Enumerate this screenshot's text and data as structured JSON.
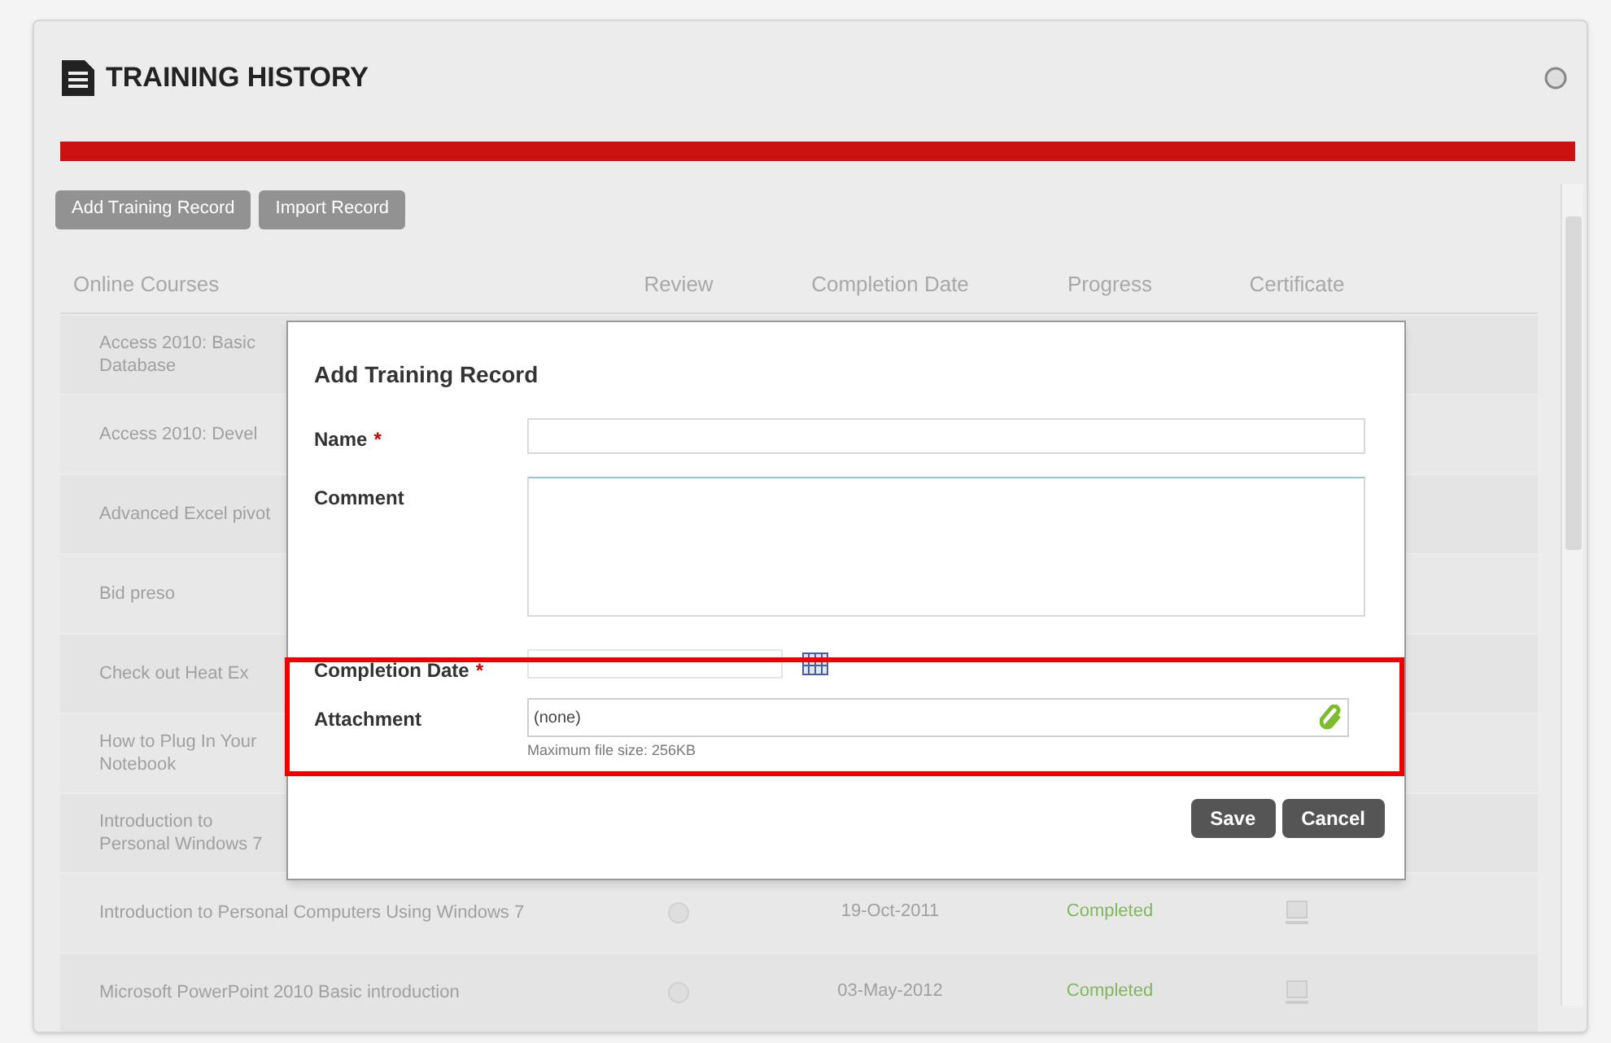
{
  "panel": {
    "title": "TRAINING HISTORY",
    "buttons": [
      "Add Training Record",
      "Import Record"
    ]
  },
  "table": {
    "columns": [
      "Online Courses",
      "Review",
      "Completion Date",
      "Progress",
      "Certificate"
    ],
    "rows": [
      {
        "course": "Access 2010: Basic Database"
      },
      {
        "course": "Access 2010: Devel"
      },
      {
        "course": "Advanced Excel pivot"
      },
      {
        "course": "Bid preso"
      },
      {
        "course": "Check out Heat Ex"
      },
      {
        "course": "How to Plug In Your Notebook"
      },
      {
        "course": "Introduction to Personal Windows 7"
      },
      {
        "course": "Introduction to Personal Computers Using Windows 7",
        "date": "19-Oct-2011",
        "progress": "Completed"
      },
      {
        "course": "Microsoft PowerPoint 2010 Basic introduction",
        "date": "03-May-2012",
        "progress": "Completed"
      }
    ]
  },
  "dialog": {
    "title": "Add Training Record",
    "fields": [
      {
        "kind": "text",
        "label": "Name",
        "required_mark": "*"
      },
      {
        "kind": "textarea",
        "label": "Comment"
      },
      {
        "kind": "date",
        "label": "Completion Date",
        "required_mark": "*"
      },
      {
        "kind": "file",
        "label": "Attachment",
        "value": "(none)",
        "hint": "Maximum file size: 256KB"
      }
    ],
    "buttons": [
      "Save",
      "Cancel"
    ]
  }
}
